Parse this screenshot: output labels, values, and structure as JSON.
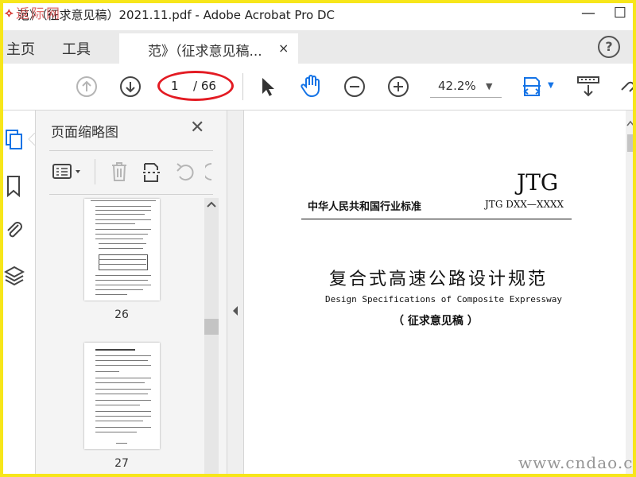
{
  "window": {
    "title": "范》（征求意见稿）2021.11.pdf - Adobe Acrobat Pro DC",
    "title_overlay": "返际网",
    "controls": [
      "—",
      "☐"
    ]
  },
  "tabs": {
    "home": "主页",
    "tools": "工具",
    "document": "范》（征求意见稿...",
    "close": "×",
    "help": "?"
  },
  "toolbar": {
    "page_current": "1",
    "page_total": "/ 66",
    "zoom": "42.2%",
    "zoom_arrow": "▼",
    "fit_arrow": "▼"
  },
  "thumbnails": {
    "title": "页面缩略图",
    "close": "✕",
    "pages": [
      {
        "label": "26"
      },
      {
        "label": "27"
      }
    ]
  },
  "document": {
    "code": "JTG",
    "category": "中华人民共和国行业标准",
    "std_number": "JTG DXX—XXXX",
    "title_cn": "复合式高速公路设计规范",
    "title_en": "Design Specifications of Composite Expressway",
    "draft": "（ 征求意见稿 ）"
  },
  "watermark": "www.cndao.com",
  "colors": {
    "accent_blue": "#1473e6",
    "annotation_red": "#e31b23",
    "frame_yellow": "#f7e61a"
  }
}
